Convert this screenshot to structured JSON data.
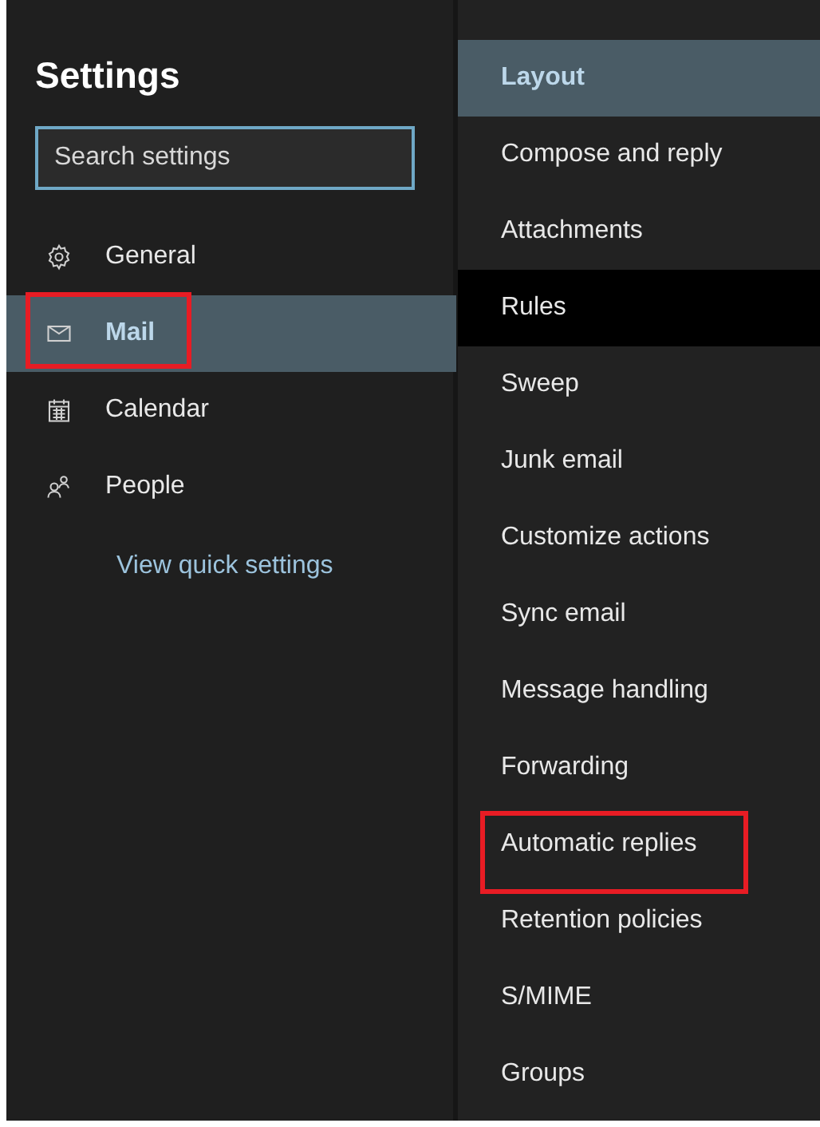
{
  "title": "Settings",
  "search": {
    "placeholder": "Search settings"
  },
  "nav": [
    {
      "label": "General",
      "kind": "gear",
      "selected": false,
      "highlighted": false
    },
    {
      "label": "Mail",
      "kind": "mail",
      "selected": true,
      "highlighted": true
    },
    {
      "label": "Calendar",
      "kind": "calendar",
      "selected": false,
      "highlighted": false
    },
    {
      "label": "People",
      "kind": "people",
      "selected": false,
      "highlighted": false
    }
  ],
  "quick_settings_link": "View quick settings",
  "sections": [
    {
      "label": "Layout",
      "selected": true,
      "hovered": false,
      "highlighted": false
    },
    {
      "label": "Compose and reply",
      "selected": false,
      "hovered": false,
      "highlighted": false
    },
    {
      "label": "Attachments",
      "selected": false,
      "hovered": false,
      "highlighted": false
    },
    {
      "label": "Rules",
      "selected": false,
      "hovered": true,
      "highlighted": false
    },
    {
      "label": "Sweep",
      "selected": false,
      "hovered": false,
      "highlighted": false
    },
    {
      "label": "Junk email",
      "selected": false,
      "hovered": false,
      "highlighted": false
    },
    {
      "label": "Customize actions",
      "selected": false,
      "hovered": false,
      "highlighted": false
    },
    {
      "label": "Sync email",
      "selected": false,
      "hovered": false,
      "highlighted": false
    },
    {
      "label": "Message handling",
      "selected": false,
      "hovered": false,
      "highlighted": false
    },
    {
      "label": "Forwarding",
      "selected": false,
      "hovered": false,
      "highlighted": false
    },
    {
      "label": "Automatic replies",
      "selected": false,
      "hovered": false,
      "highlighted": true
    },
    {
      "label": "Retention policies",
      "selected": false,
      "hovered": false,
      "highlighted": false
    },
    {
      "label": "S/MIME",
      "selected": false,
      "hovered": false,
      "highlighted": false
    },
    {
      "label": "Groups",
      "selected": false,
      "hovered": false,
      "highlighted": false
    }
  ]
}
